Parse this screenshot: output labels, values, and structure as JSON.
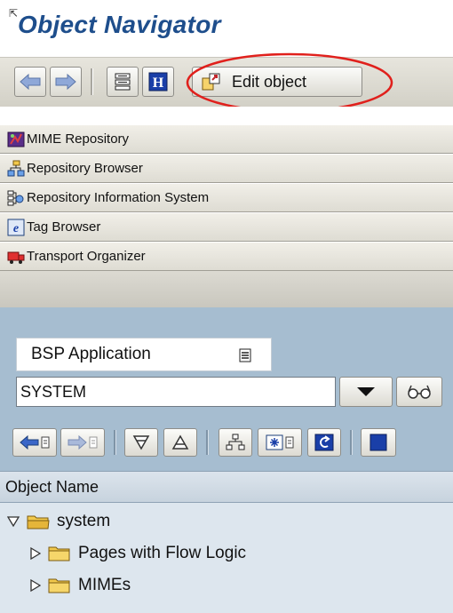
{
  "window": {
    "title": "Object Navigator"
  },
  "toolbar": {
    "edit_object_label": "Edit object"
  },
  "tray": {
    "items": [
      {
        "label": "MIME Repository",
        "icon": "mime-repository-icon"
      },
      {
        "label": "Repository Browser",
        "icon": "repository-browser-icon"
      },
      {
        "label": "Repository Information System",
        "icon": "repository-info-system-icon"
      },
      {
        "label": "Tag Browser",
        "icon": "tag-browser-icon"
      },
      {
        "label": "Transport Organizer",
        "icon": "transport-organizer-icon"
      }
    ]
  },
  "object_selector": {
    "type_label": "BSP Application",
    "input_value": "SYSTEM"
  },
  "tree": {
    "column_header": "Object Name",
    "rows": [
      {
        "label": "system",
        "expanded": true,
        "level": 0
      },
      {
        "label": "Pages with Flow Logic",
        "expanded": false,
        "level": 1
      },
      {
        "label": "MIMEs",
        "expanded": false,
        "level": 1
      }
    ]
  },
  "colors": {
    "title": "#1e4e8c",
    "panel_background": "#a6bdd0",
    "highlight_ellipse": "#e0201c",
    "folder": "#f2c94c"
  }
}
